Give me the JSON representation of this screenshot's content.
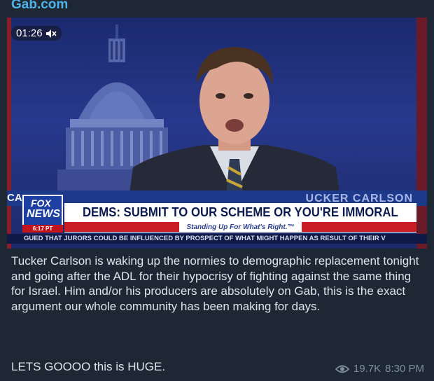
{
  "header": {
    "site": "Gab.com"
  },
  "video": {
    "duration": "01:26",
    "muted_icon": "speaker-muted-icon",
    "chyron_left": "CA",
    "chyron_name": "UCKER CARLSON",
    "logo_top": "FOX",
    "logo_bottom": "NEWS",
    "logo_time": "6:17 PT",
    "headline": "DEMS: SUBMIT TO OUR SCHEME OR YOU'RE IMMORAL",
    "tagline": "Standing Up For What's Right.™",
    "ticker": "GUED THAT JURORS COULD BE INFLUENCED BY PROSPECT OF WHAT MIGHT HAPPEN AS RESULT OF THEIR V",
    "colors": {
      "fox_blue": "#1d3fa1",
      "fox_red": "#c3141b",
      "headline_navy": "#0b1a4e"
    }
  },
  "message": {
    "body": "Tucker Carlson is waking up the normies to demographic replacement tonight and going after the ADL for their hypocrisy of fighting against the same thing for Israel. Him and/or his producers are absolutely on Gab, this is the exact argument our whole community has been making for days.",
    "closing": "LETS GOOOO this is HUGE."
  },
  "meta": {
    "views": "19.7K",
    "time": "8:30 PM",
    "views_icon": "eye-icon"
  },
  "colors": {
    "background": "#1e2835",
    "link": "#4fb3e8",
    "text": "#dde3ea",
    "meta": "#7f8d9c"
  }
}
